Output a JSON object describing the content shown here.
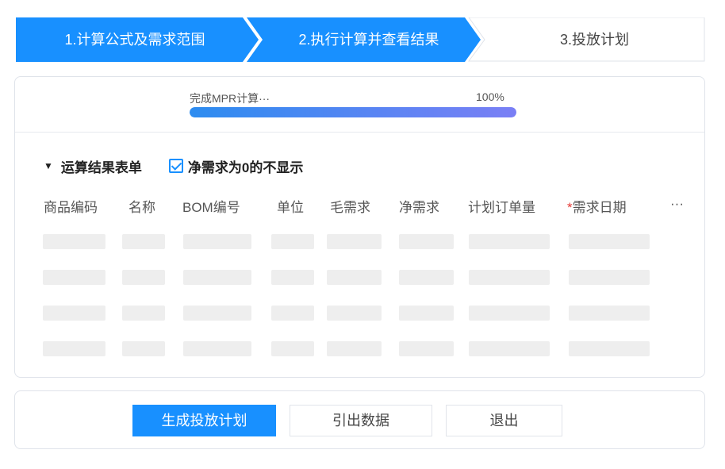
{
  "stepper": {
    "steps": [
      {
        "label": "1.计算公式及需求范围",
        "state": "done"
      },
      {
        "label": "2.执行计算并查看结果",
        "state": "active"
      },
      {
        "label": "3.投放计划",
        "state": "pending"
      }
    ],
    "active_color": "#1890ff"
  },
  "progress": {
    "text": "完成MPR计算···",
    "percent_text": "100%",
    "value": 1.0
  },
  "result": {
    "title": "运算结果表单",
    "collapse_icon": "triangle-down-icon",
    "checkbox_label": "净需求为0的不显示",
    "checkbox_checked": true,
    "columns": [
      "商品编码",
      "名称",
      "BOM编号",
      "单位",
      "毛需求",
      "净需求",
      "计划订单量",
      "需求日期"
    ],
    "required_mark": "*",
    "more": "···",
    "skeleton_rows": 4
  },
  "actions": {
    "generate": "生成投放计划",
    "export": "引出数据",
    "exit": "退出"
  }
}
